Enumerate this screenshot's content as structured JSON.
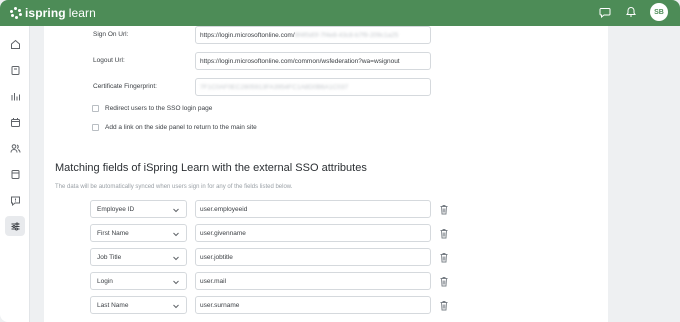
{
  "app": {
    "logo_bold": "ispring",
    "logo_light": " learn",
    "avatar_initials": "SB",
    "brand_color": "#4d8c57"
  },
  "topbar_icons": [
    "chat-icon",
    "bell-icon"
  ],
  "sidebar": {
    "items": [
      {
        "icon": "home-icon"
      },
      {
        "icon": "book-icon"
      },
      {
        "icon": "reports-chart-icon"
      },
      {
        "icon": "calendar-icon"
      },
      {
        "icon": "users-icon"
      },
      {
        "icon": "tasks-icon"
      },
      {
        "icon": "feedback-icon"
      },
      {
        "icon": "settings-sliders-icon",
        "active": true
      }
    ]
  },
  "sso": {
    "sign_on_url_label": "Sign On Url:",
    "sign_on_url_value": "https://login.microsoftonline.com/",
    "sign_on_url_blurred": "9f4f0d0f-7f4e8-43c8-b7f9-209c1a25",
    "logout_url_label": "Logout Url:",
    "logout_url_value": "https://login.microsoftonline.com/common/wsfederation?wa=wsignout",
    "certificate_label": "Certificate Fingerprint:",
    "certificate_blurred": "7F1C0AF0EC2805913FA3954FC1A8D0B6A1C037",
    "redirect_checkbox_label": "Redirect users to the SSO login page",
    "return_link_checkbox_label": "Add a link on the side panel to return to the main site"
  },
  "mapping": {
    "title": "Matching fields of iSpring Learn with the external SSO attributes",
    "description": "The data will be automatically synced when users sign in for any of the fields listed below.",
    "rows": [
      {
        "field": "Employee ID",
        "attribute": "user.employeeid"
      },
      {
        "field": "First Name",
        "attribute": "user.givenname"
      },
      {
        "field": "Job Title",
        "attribute": "user.jobtitle"
      },
      {
        "field": "Login",
        "attribute": "user.mail"
      },
      {
        "field": "Last Name",
        "attribute": "user.surname"
      }
    ]
  }
}
